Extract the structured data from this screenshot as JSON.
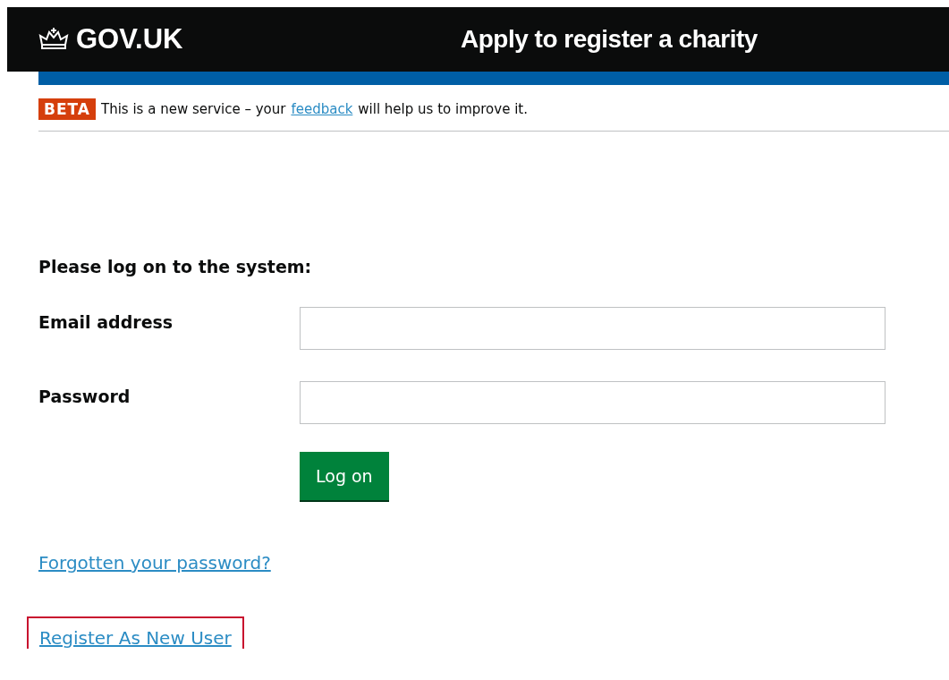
{
  "header": {
    "logo": "GOV.UK",
    "service_name": "Apply to register a charity"
  },
  "phase_banner": {
    "tag": "BETA",
    "text_before": "This is a new service – your",
    "link": "feedback",
    "text_after": "will help us to improve it."
  },
  "form": {
    "heading": "Please log on to the system:",
    "fields": [
      {
        "label": "Email address"
      },
      {
        "label": "Password"
      }
    ],
    "submit": "Log on"
  },
  "links": [
    {
      "text": "Forgotten your password?",
      "highlighted": false
    },
    {
      "text": "Register As New User",
      "highlighted": true
    }
  ]
}
